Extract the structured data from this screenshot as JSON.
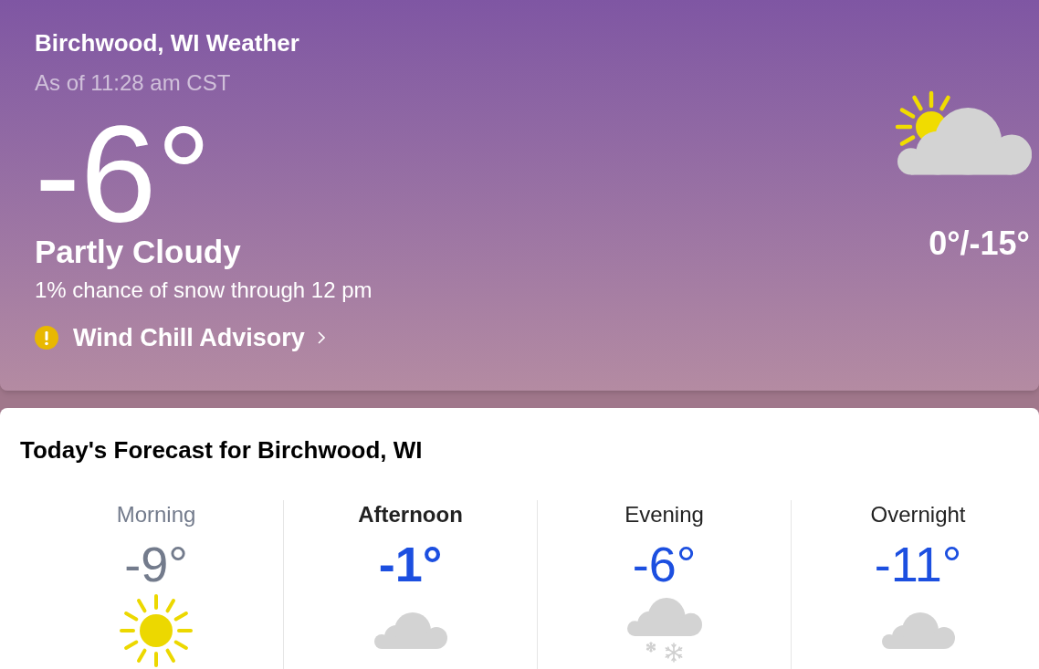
{
  "current": {
    "title": "Birchwood, WI Weather",
    "updated": "As of 11:28 am CST",
    "temperature": "-6°",
    "condition": "Partly Cloudy",
    "precipitation": "1% chance of snow through 12 pm",
    "alert": "Wind Chill Advisory",
    "high_low": "0°/-15°"
  },
  "forecast": {
    "title": "Today's Forecast for Birchwood, WI",
    "periods": [
      {
        "label": "Morning",
        "temperature": "-9°",
        "kind": "sunny",
        "past": true,
        "current": false
      },
      {
        "label": "Afternoon",
        "temperature": "-1°",
        "kind": "cloudy",
        "past": false,
        "current": true
      },
      {
        "label": "Evening",
        "temperature": "-6°",
        "kind": "snow",
        "past": false,
        "current": false
      },
      {
        "label": "Overnight",
        "temperature": "-11°",
        "kind": "cloudy",
        "past": false,
        "current": false
      }
    ]
  }
}
